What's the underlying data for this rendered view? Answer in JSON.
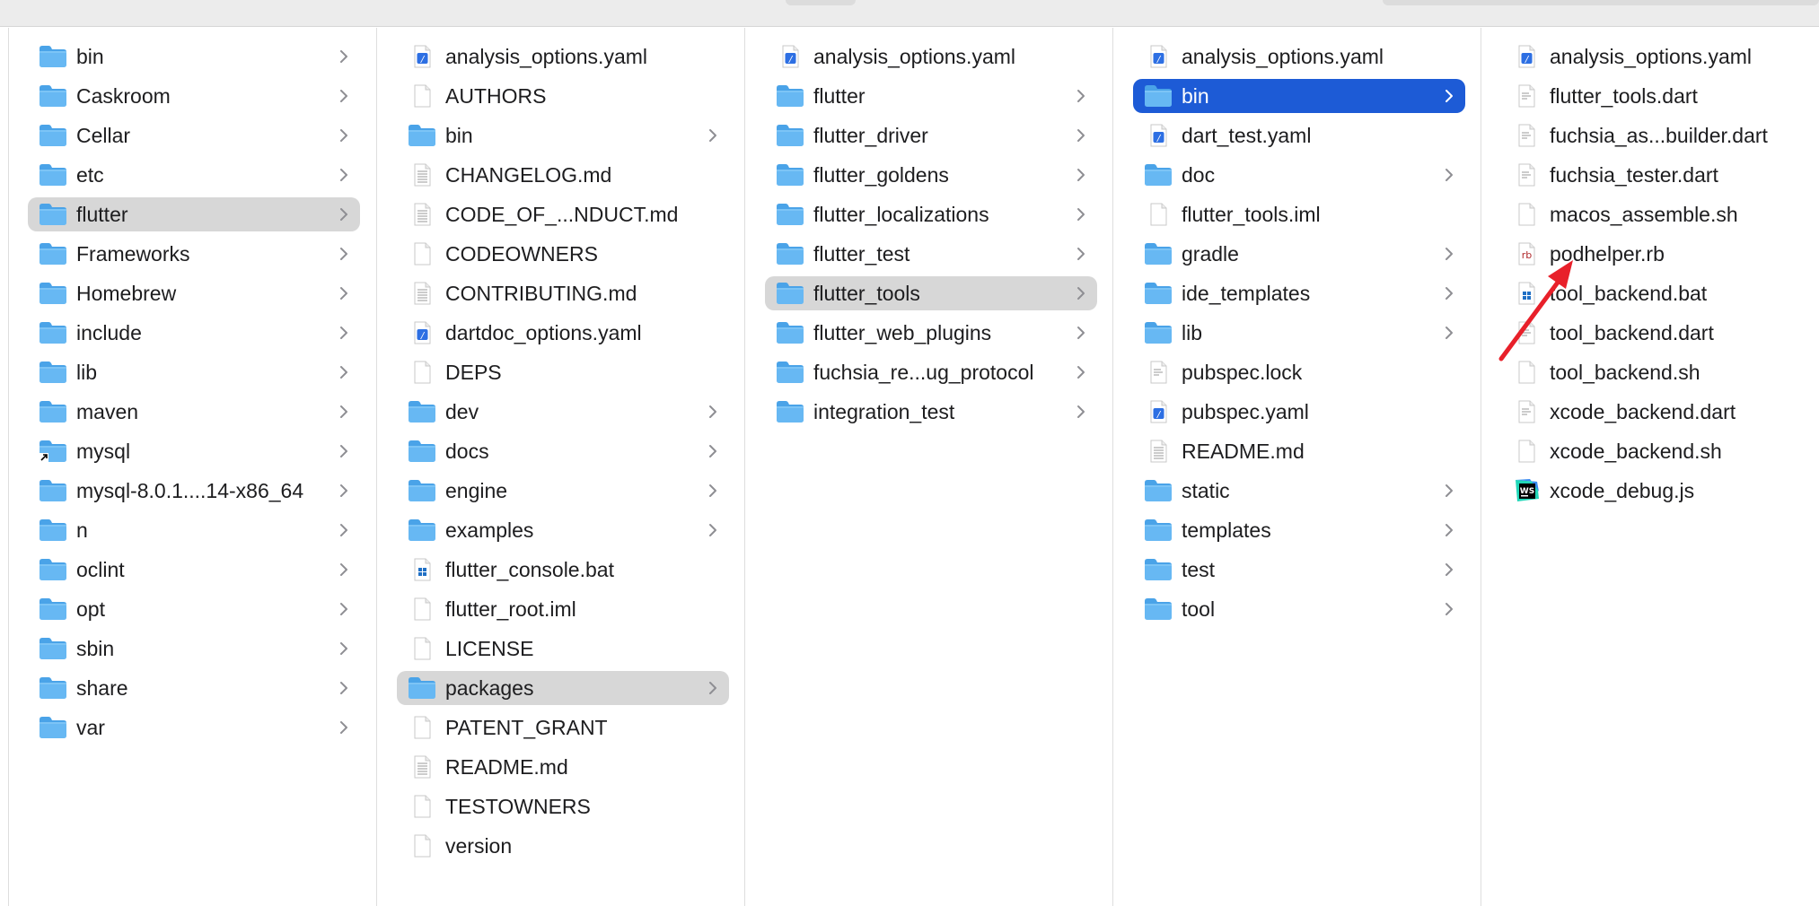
{
  "accent": "#1d5bd6",
  "columns": [
    {
      "items": [
        {
          "label": "bin",
          "type": "folder",
          "chevron": true
        },
        {
          "label": "Caskroom",
          "type": "folder",
          "chevron": true
        },
        {
          "label": "Cellar",
          "type": "folder",
          "chevron": true
        },
        {
          "label": "etc",
          "type": "folder",
          "chevron": true
        },
        {
          "label": "flutter",
          "type": "folder",
          "chevron": true,
          "state": "path"
        },
        {
          "label": "Frameworks",
          "type": "folder",
          "chevron": true
        },
        {
          "label": "Homebrew",
          "type": "folder",
          "chevron": true
        },
        {
          "label": "include",
          "type": "folder",
          "chevron": true
        },
        {
          "label": "lib",
          "type": "folder",
          "chevron": true
        },
        {
          "label": "maven",
          "type": "folder",
          "chevron": true
        },
        {
          "label": "mysql",
          "type": "folder-alias",
          "chevron": true
        },
        {
          "label": "mysql-8.0.1....14-x86_64",
          "type": "folder",
          "chevron": true
        },
        {
          "label": "n",
          "type": "folder",
          "chevron": true
        },
        {
          "label": "oclint",
          "type": "folder",
          "chevron": true
        },
        {
          "label": "opt",
          "type": "folder",
          "chevron": true
        },
        {
          "label": "sbin",
          "type": "folder",
          "chevron": true
        },
        {
          "label": "share",
          "type": "folder",
          "chevron": true
        },
        {
          "label": "var",
          "type": "folder",
          "chevron": true
        }
      ]
    },
    {
      "items": [
        {
          "label": "analysis_options.yaml",
          "type": "yaml"
        },
        {
          "label": "AUTHORS",
          "type": "doc"
        },
        {
          "label": "bin",
          "type": "folder",
          "chevron": true
        },
        {
          "label": "CHANGELOG.md",
          "type": "text"
        },
        {
          "label": "CODE_OF_...NDUCT.md",
          "type": "text"
        },
        {
          "label": "CODEOWNERS",
          "type": "doc"
        },
        {
          "label": "CONTRIBUTING.md",
          "type": "text"
        },
        {
          "label": "dartdoc_options.yaml",
          "type": "yaml"
        },
        {
          "label": "DEPS",
          "type": "doc"
        },
        {
          "label": "dev",
          "type": "folder",
          "chevron": true
        },
        {
          "label": "docs",
          "type": "folder",
          "chevron": true
        },
        {
          "label": "engine",
          "type": "folder",
          "chevron": true
        },
        {
          "label": "examples",
          "type": "folder",
          "chevron": true
        },
        {
          "label": "flutter_console.bat",
          "type": "bat"
        },
        {
          "label": "flutter_root.iml",
          "type": "doc"
        },
        {
          "label": "LICENSE",
          "type": "doc"
        },
        {
          "label": "packages",
          "type": "folder",
          "chevron": true,
          "state": "path"
        },
        {
          "label": "PATENT_GRANT",
          "type": "doc"
        },
        {
          "label": "README.md",
          "type": "text"
        },
        {
          "label": "TESTOWNERS",
          "type": "doc"
        },
        {
          "label": "version",
          "type": "doc"
        }
      ]
    },
    {
      "items": [
        {
          "label": "analysis_options.yaml",
          "type": "yaml"
        },
        {
          "label": "flutter",
          "type": "folder",
          "chevron": true
        },
        {
          "label": "flutter_driver",
          "type": "folder",
          "chevron": true
        },
        {
          "label": "flutter_goldens",
          "type": "folder",
          "chevron": true
        },
        {
          "label": "flutter_localizations",
          "type": "folder",
          "chevron": true
        },
        {
          "label": "flutter_test",
          "type": "folder",
          "chevron": true
        },
        {
          "label": "flutter_tools",
          "type": "folder",
          "chevron": true,
          "state": "path"
        },
        {
          "label": "flutter_web_plugins",
          "type": "folder",
          "chevron": true
        },
        {
          "label": "fuchsia_re...ug_protocol",
          "type": "folder",
          "chevron": true
        },
        {
          "label": "integration_test",
          "type": "folder",
          "chevron": true
        }
      ]
    },
    {
      "items": [
        {
          "label": "analysis_options.yaml",
          "type": "yaml"
        },
        {
          "label": "bin",
          "type": "folder",
          "chevron": true,
          "state": "selected"
        },
        {
          "label": "dart_test.yaml",
          "type": "yaml"
        },
        {
          "label": "doc",
          "type": "folder",
          "chevron": true
        },
        {
          "label": "flutter_tools.iml",
          "type": "doc"
        },
        {
          "label": "gradle",
          "type": "folder",
          "chevron": true
        },
        {
          "label": "ide_templates",
          "type": "folder",
          "chevron": true
        },
        {
          "label": "lib",
          "type": "folder",
          "chevron": true
        },
        {
          "label": "pubspec.lock",
          "type": "lines"
        },
        {
          "label": "pubspec.yaml",
          "type": "yaml"
        },
        {
          "label": "README.md",
          "type": "text"
        },
        {
          "label": "static",
          "type": "folder",
          "chevron": true
        },
        {
          "label": "templates",
          "type": "folder",
          "chevron": true
        },
        {
          "label": "test",
          "type": "folder",
          "chevron": true
        },
        {
          "label": "tool",
          "type": "folder",
          "chevron": true
        }
      ]
    },
    {
      "items": [
        {
          "label": "analysis_options.yaml",
          "type": "yaml"
        },
        {
          "label": "flutter_tools.dart",
          "type": "lines"
        },
        {
          "label": "fuchsia_as...builder.dart",
          "type": "lines"
        },
        {
          "label": "fuchsia_tester.dart",
          "type": "lines"
        },
        {
          "label": "macos_assemble.sh",
          "type": "doc"
        },
        {
          "label": "podhelper.rb",
          "type": "rb"
        },
        {
          "label": "tool_backend.bat",
          "type": "bat"
        },
        {
          "label": "tool_backend.dart",
          "type": "lines"
        },
        {
          "label": "tool_backend.sh",
          "type": "doc"
        },
        {
          "label": "xcode_backend.dart",
          "type": "lines"
        },
        {
          "label": "xcode_backend.sh",
          "type": "doc"
        },
        {
          "label": "xcode_debug.js",
          "type": "js"
        }
      ]
    }
  ],
  "icons": {
    "folder": "folder-icon",
    "folder-alias": "folder-alias-icon",
    "yaml": "yaml-file-icon",
    "doc": "document-icon",
    "text": "text-document-icon",
    "lines": "code-file-icon",
    "bat": "windows-batch-icon",
    "rb": "ruby-file-icon",
    "js": "webstorm-js-icon"
  }
}
